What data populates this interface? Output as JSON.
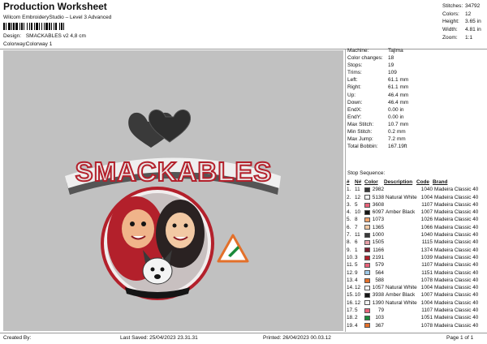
{
  "header": {
    "title": "Production Worksheet",
    "subtitle": "Wilcom EmbroideryStudio – Level 3 Advanced",
    "design_label": "Design:",
    "design_value": "SMACKABLES v2 4,8 cm",
    "colorway_label": "Colorway:",
    "colorway_value": "Colorway 1"
  },
  "stats": [
    {
      "label": "Stitches:",
      "value": "34792"
    },
    {
      "label": "Colors:",
      "value": "12"
    },
    {
      "label": "Height:",
      "value": "3.65 in"
    },
    {
      "label": "Width:",
      "value": "4.81 in"
    },
    {
      "label": "Zoom:",
      "value": "1:1"
    }
  ],
  "info": [
    {
      "label": "Machine:",
      "value": "Tajima"
    },
    {
      "label": "Color changes:",
      "value": "18"
    },
    {
      "label": "Stops:",
      "value": "19"
    },
    {
      "label": "Trims:",
      "value": "109"
    },
    {
      "label": "Left:",
      "value": "61.1 mm"
    },
    {
      "label": "Right:",
      "value": "61.1 mm"
    },
    {
      "label": "Up:",
      "value": "46.4 mm"
    },
    {
      "label": "Down:",
      "value": "46.4 mm"
    },
    {
      "label": "EndX:",
      "value": "0.00 in"
    },
    {
      "label": "EndY:",
      "value": "0.00 in"
    },
    {
      "label": "Max Stitch:",
      "value": "10.7 mm"
    },
    {
      "label": "Min Stitch:",
      "value": "0.2 mm"
    },
    {
      "label": "Max Jump:",
      "value": "7.2 mm"
    },
    {
      "label": "Total Bobbin:",
      "value": "167.19ft"
    }
  ],
  "sequence": {
    "label": "Stop Sequence:",
    "headers": {
      "num": "#",
      "n": "N#",
      "color": "Color",
      "st": "St.",
      "desc": "Description",
      "code": "Code",
      "brand": "Brand"
    },
    "rows": [
      {
        "num": "1.",
        "n": "11",
        "hex": "#3a3a3a",
        "st": "2982",
        "desc": "",
        "code": "1040",
        "brand": "Madeira Classic 40"
      },
      {
        "num": "2.",
        "n": "12",
        "hex": "#f4f4f4",
        "st": "5138",
        "desc": "Natural White",
        "code": "1004",
        "brand": "Madeira Classic 40"
      },
      {
        "num": "3.",
        "n": "5",
        "hex": "#e8637a",
        "st": "3608",
        "desc": "",
        "code": "1107",
        "brand": "Madeira Classic 40"
      },
      {
        "num": "4.",
        "n": "10",
        "hex": "#151515",
        "st": "6097",
        "desc": "Amber Black",
        "code": "1007",
        "brand": "Madeira Classic 40"
      },
      {
        "num": "5.",
        "n": "8",
        "hex": "#f0a36c",
        "st": "1073",
        "desc": "",
        "code": "1026",
        "brand": "Madeira Classic 40"
      },
      {
        "num": "6.",
        "n": "7",
        "hex": "#f2c9a4",
        "st": "1365",
        "desc": "",
        "code": "1066",
        "brand": "Madeira Classic 40"
      },
      {
        "num": "7.",
        "n": "11",
        "hex": "#3a3a3a",
        "st": "1000",
        "desc": "",
        "code": "1040",
        "brand": "Madeira Classic 40"
      },
      {
        "num": "8.",
        "n": "6",
        "hex": "#e6a0a8",
        "st": "1505",
        "desc": "",
        "code": "1115",
        "brand": "Madeira Classic 40"
      },
      {
        "num": "9.",
        "n": "1",
        "hex": "#7a2030",
        "st": "1166",
        "desc": "",
        "code": "1374",
        "brand": "Madeira Classic 40"
      },
      {
        "num": "10.",
        "n": "3",
        "hex": "#b3202b",
        "st": "2191",
        "desc": "",
        "code": "1039",
        "brand": "Madeira Classic 40"
      },
      {
        "num": "11.",
        "n": "5",
        "hex": "#e8637a",
        "st": "579",
        "desc": "",
        "code": "1107",
        "brand": "Madeira Classic 40"
      },
      {
        "num": "12.",
        "n": "9",
        "hex": "#9ec9e8",
        "st": "564",
        "desc": "",
        "code": "1151",
        "brand": "Madeira Classic 40"
      },
      {
        "num": "13.",
        "n": "4",
        "hex": "#e3702a",
        "st": "588",
        "desc": "",
        "code": "1078",
        "brand": "Madeira Classic 40"
      },
      {
        "num": "14.",
        "n": "12",
        "hex": "#f4f4f4",
        "st": "1057",
        "desc": "Natural White",
        "code": "1004",
        "brand": "Madeira Classic 40"
      },
      {
        "num": "15.",
        "n": "10",
        "hex": "#151515",
        "st": "3938",
        "desc": "Amber Black",
        "code": "1007",
        "brand": "Madeira Classic 40"
      },
      {
        "num": "16.",
        "n": "12",
        "hex": "#f4f4f4",
        "st": "1390",
        "desc": "Natural White",
        "code": "1004",
        "brand": "Madeira Classic 40"
      },
      {
        "num": "17.",
        "n": "5",
        "hex": "#e8637a",
        "st": "79",
        "desc": "",
        "code": "1107",
        "brand": "Madeira Classic 40"
      },
      {
        "num": "18.",
        "n": "2",
        "hex": "#1a8a3a",
        "st": "103",
        "desc": "",
        "code": "1051",
        "brand": "Madeira Classic 40"
      },
      {
        "num": "19.",
        "n": "4",
        "hex": "#e3702a",
        "st": "367",
        "desc": "",
        "code": "1078",
        "brand": "Madeira Classic 40"
      }
    ]
  },
  "design_text": "SMACKABLES",
  "footer": {
    "created_by": "Created By:",
    "last_saved": "Last Saved: 25/04/2023 23.31.31",
    "printed": "Printed: 26/04/2023 00.03.12",
    "page": "Page 1 of 1"
  },
  "colors": {
    "canvas_bg": "#c1c1c1",
    "logo_red": "#b3202b",
    "logo_dark": "#3a3a3a"
  }
}
